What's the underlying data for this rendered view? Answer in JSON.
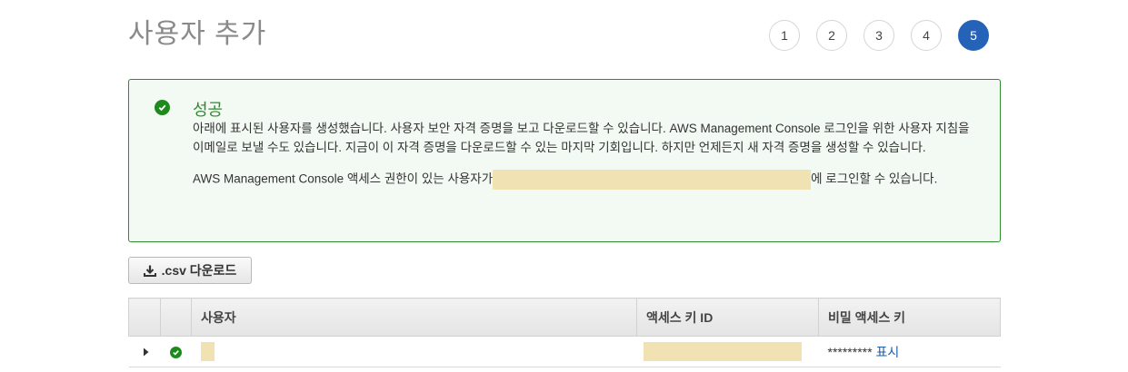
{
  "page": {
    "title": "사용자 추가"
  },
  "steps": [
    "1",
    "2",
    "3",
    "4",
    "5"
  ],
  "alert": {
    "title": "성공",
    "body": "아래에 표시된 사용자를 생성했습니다. 사용자 보안 자격 증명을 보고 다운로드할 수 있습니다. AWS Management Console 로그인을 위한 사용자 지침을 이메일로 보낼 수도 있습니다. 지금이 이 자격 증명을 다운로드할 수 있는 마지막 기회입니다. 하지만 언제든지 새 자격 증명을 생성할 수 있습니다.",
    "console_prefix": "AWS Management Console 액세스 권한이 있는 사용자가",
    "console_suffix": "에 로그인할 수 있습니다."
  },
  "toolbar": {
    "csv_label": ".csv 다운로드"
  },
  "table": {
    "headers": {
      "user": "사용자",
      "access_key": "액세스 키 ID",
      "secret_key": "비밀 액세스 키"
    },
    "rows": [
      {
        "secret_mask": "*********",
        "show_label": "표시"
      }
    ]
  }
}
